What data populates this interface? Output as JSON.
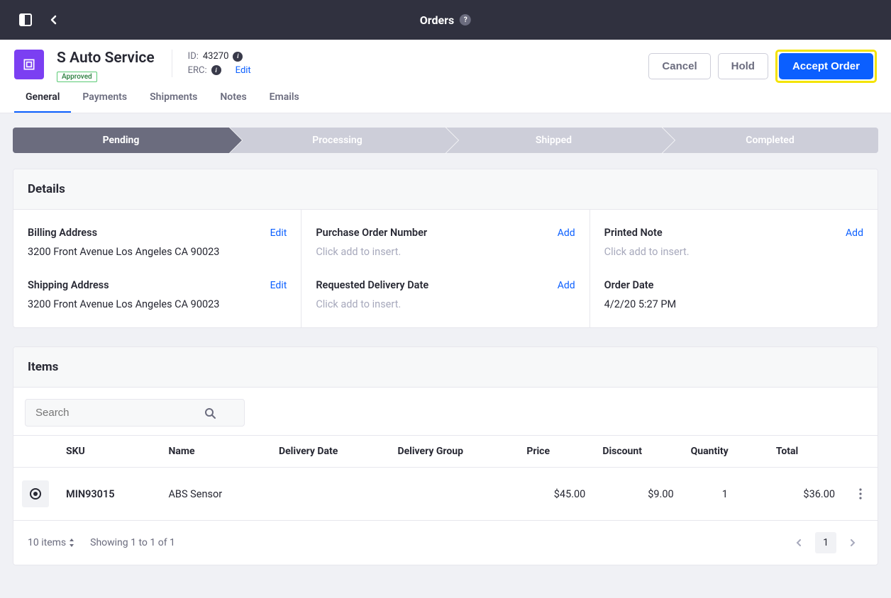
{
  "topbar": {
    "title": "Orders"
  },
  "header": {
    "company": "S Auto Service",
    "badge": "Approved",
    "id_label": "ID:",
    "id_value": "43270",
    "erc_label": "ERC:",
    "edit": "Edit"
  },
  "actions": {
    "cancel": "Cancel",
    "hold": "Hold",
    "accept": "Accept Order"
  },
  "tabs": [
    "General",
    "Payments",
    "Shipments",
    "Notes",
    "Emails"
  ],
  "steps": [
    "Pending",
    "Processing",
    "Shipped",
    "Completed"
  ],
  "details": {
    "title": "Details",
    "edit": "Edit",
    "add": "Add",
    "billing": {
      "label": "Billing Address",
      "value": "3200 Front Avenue Los Angeles CA 90023"
    },
    "shipping": {
      "label": "Shipping Address",
      "value": "3200 Front Avenue Los Angeles CA 90023"
    },
    "po": {
      "label": "Purchase Order Number",
      "value": "Click add to insert."
    },
    "req_date": {
      "label": "Requested Delivery Date",
      "value": "Click add to insert."
    },
    "note": {
      "label": "Printed Note",
      "value": "Click add to insert."
    },
    "order_date": {
      "label": "Order Date",
      "value": "4/2/20 5:27 PM"
    }
  },
  "items": {
    "title": "Items",
    "search_placeholder": "Search",
    "cols": {
      "sku": "SKU",
      "name": "Name",
      "delivery_date": "Delivery Date",
      "delivery_group": "Delivery Group",
      "price": "Price",
      "discount": "Discount",
      "quantity": "Quantity",
      "total": "Total"
    },
    "rows": [
      {
        "sku": "MIN93015",
        "name": "ABS Sensor",
        "delivery_date": "",
        "delivery_group": "",
        "price": "$45.00",
        "discount": "$9.00",
        "quantity": "1",
        "total": "$36.00"
      }
    ],
    "footer": {
      "per_page": "10 items",
      "showing": "Showing 1 to 1 of 1",
      "page": "1"
    }
  }
}
